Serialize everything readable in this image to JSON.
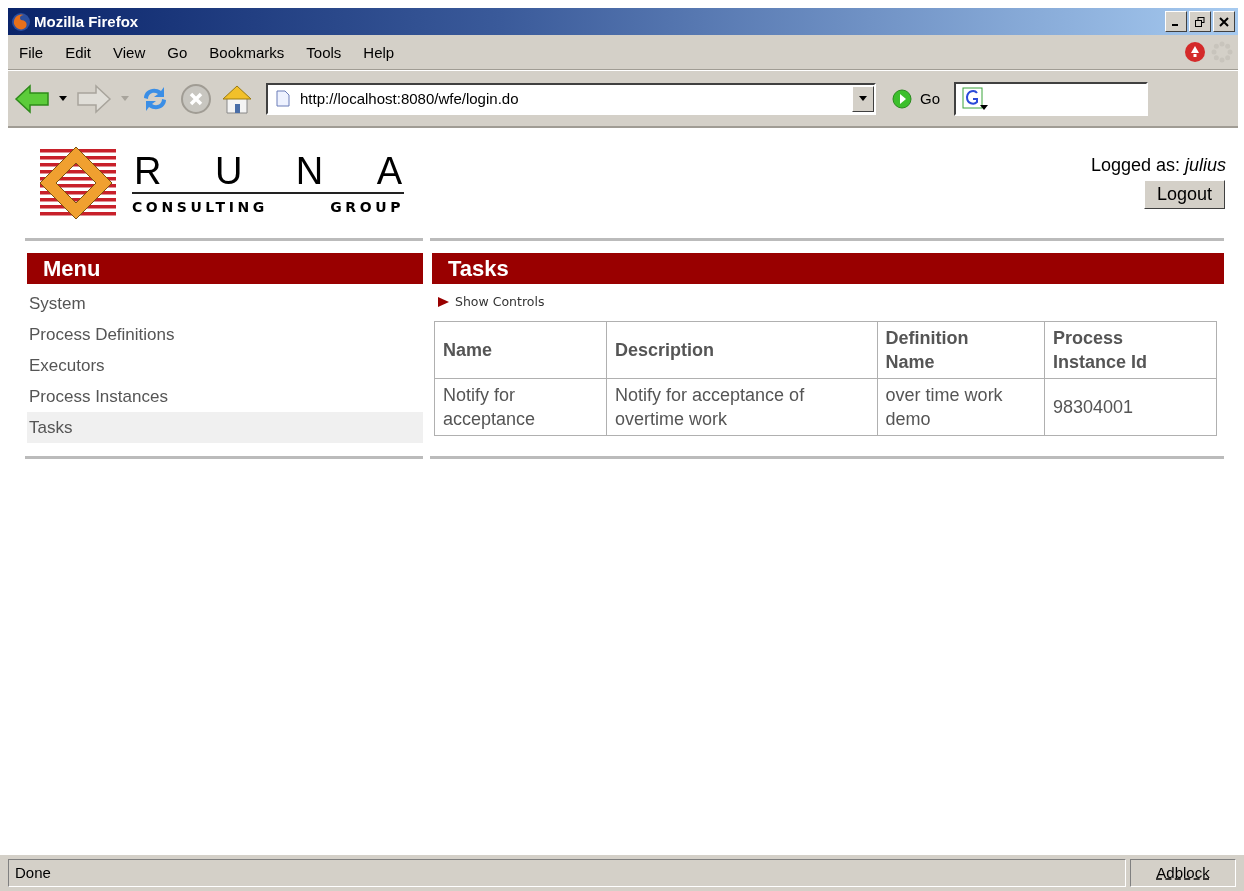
{
  "window": {
    "title": "Mozilla Firefox"
  },
  "menu_bar": [
    "File",
    "Edit",
    "View",
    "Go",
    "Bookmarks",
    "Tools",
    "Help"
  ],
  "toolbar": {
    "address": "http://localhost:8080/wfe/login.do",
    "go_label": "Go"
  },
  "header": {
    "logo": {
      "letters": [
        "R",
        "U",
        "N",
        "A"
      ],
      "subtitle": [
        "CONSULTING",
        "GROUP"
      ]
    },
    "logged_as_label": "Logged as:",
    "user": "julius",
    "logout_button": "Logout"
  },
  "sidebar": {
    "title": "Menu",
    "items": [
      {
        "label": "System",
        "selected": false
      },
      {
        "label": "Process Definitions",
        "selected": false
      },
      {
        "label": "Executors",
        "selected": false
      },
      {
        "label": "Process Instances",
        "selected": false
      },
      {
        "label": "Tasks",
        "selected": true
      }
    ]
  },
  "main": {
    "title": "Tasks",
    "show_controls": "Show Controls",
    "table": {
      "columns": [
        "Name",
        "Description",
        "Definition Name",
        "Process Instance Id"
      ],
      "rows": [
        [
          "Notify for acceptance",
          "Notify for acceptance of overtime work",
          "over time work demo",
          "98304001"
        ]
      ]
    }
  },
  "status_bar": {
    "text": "Done",
    "panel": "Adblock"
  }
}
